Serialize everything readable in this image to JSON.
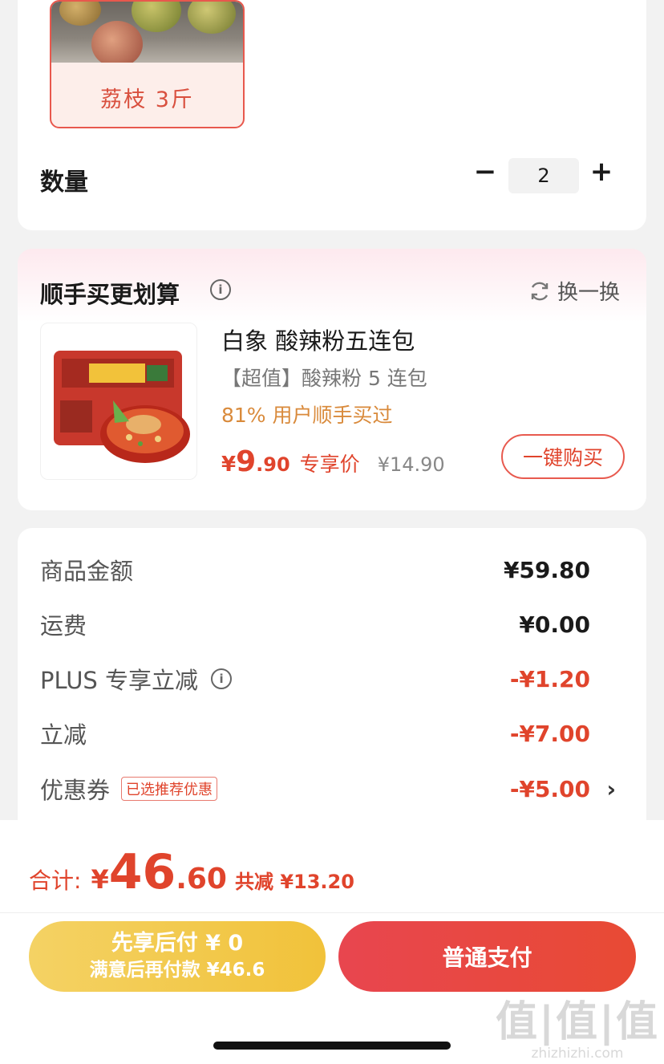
{
  "spec": {
    "option_label": "荔枝 3斤",
    "quantity_label": "数量",
    "quantity_value": "2",
    "minus_symbol": "−",
    "plus_symbol": "+"
  },
  "addon": {
    "title": "顺手买更划算",
    "refresh_label": "换一换",
    "product": {
      "name": "白象 酸辣粉五连包",
      "subtitle": "【超值】酸辣粉 5 连包",
      "stat": "81% 用户顺手买过",
      "price_symbol": "¥",
      "price_int": "9",
      "price_dec": ".90",
      "price_tag": "专享价",
      "original_price": "¥14.90",
      "buy_label": "一键购买"
    }
  },
  "summary": {
    "rows": [
      {
        "label": "商品金额",
        "value": "¥59.80"
      },
      {
        "label": "运费",
        "value": "¥0.00"
      },
      {
        "label": "PLUS 专享立减",
        "value": "-¥1.20"
      },
      {
        "label": "立减",
        "value": "-¥7.00"
      },
      {
        "label": "优惠券",
        "value": "-¥5.00"
      }
    ],
    "coupon_badge": "已选推荐优惠",
    "chevron": "›"
  },
  "bottom": {
    "total_label": "合计:",
    "total_symbol": "¥",
    "total_int": "46",
    "total_dec": ".60",
    "total_saving": "共减 ¥13.20",
    "pay_later_line1": "先享后付 ¥ 0",
    "pay_later_line2": "满意后再付款 ¥46.6",
    "pay_normal_label": "普通支付"
  },
  "watermark": {
    "main": "值|值|值",
    "sub": "zhizhizhi.com"
  },
  "colors": {
    "accent": "#e0442c",
    "pay_later": "#f1c23a",
    "stat": "#d98a3b"
  }
}
